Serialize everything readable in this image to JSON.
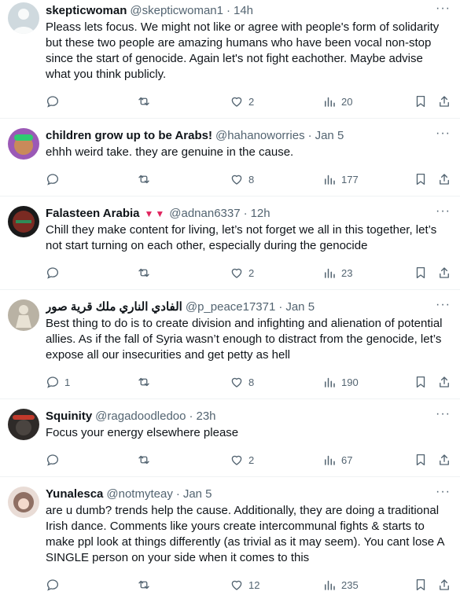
{
  "tweets": [
    {
      "name": "skepticwoman",
      "name_extra": "",
      "handle": "@skepticwoman1",
      "time": "14h",
      "text": "Pleass lets focus. We might not like or agree with people's form of solidarity but these two people are amazing humans who have been vocal non-stop since the start of genocide. Again let's not fight eachother. Maybe advise what you think publicly.",
      "replies": "",
      "retweets": "",
      "likes": "2",
      "views": "20",
      "avatar_color": "#cfd9de"
    },
    {
      "name": "children grow up to be Arabs!",
      "name_extra": "",
      "handle": "@hahanoworries",
      "time": "Jan 5",
      "text": "ehhh weird take. they are genuine in the cause.",
      "replies": "",
      "retweets": "",
      "likes": "8",
      "views": "177",
      "avatar_color": "#c98a5a"
    },
    {
      "name": "Falasteen Arabia",
      "name_extra": "▼▼",
      "handle": "@adnan6337",
      "time": "12h",
      "text": "Chill they make content for living, let’s not forget we all in this together, let’s not start turning on each other, especially during the genocide",
      "replies": "",
      "retweets": "",
      "likes": "2",
      "views": "23",
      "avatar_color": "#7a2a22"
    },
    {
      "name": "الفادي الناري ملك قرية صور",
      "name_extra": "",
      "handle": "@p_peace17371",
      "time": "Jan 5",
      "text": "Best thing to do is to create division and infighting and alienation of potential allies. As if the fall of Syria wasn’t enough to distract from the genocide, let’s expose all our insecurities and get petty as hell",
      "replies": "1",
      "retweets": "",
      "likes": "8",
      "views": "190",
      "avatar_color": "#b9b2a4"
    },
    {
      "name": "Squinity",
      "name_extra": "",
      "handle": "@ragadoodledoo",
      "time": "23h",
      "text": "Focus your energy elsewhere please",
      "replies": "",
      "retweets": "",
      "likes": "2",
      "views": "67",
      "avatar_color": "#2e2a28"
    },
    {
      "name": "Yunalesca",
      "name_extra": "",
      "handle": "@notmyteay",
      "time": "Jan 5",
      "text": "are u dumb? trends help the cause. Additionally, they are doing a traditional Irish dance. Comments like yours create intercommunal fights & starts to make ppl look at things differently (as trivial as it may seem). You cant lose A SINGLE person on your side when it comes to this",
      "replies": "",
      "retweets": "",
      "likes": "12",
      "views": "235",
      "avatar_color": "#8f6f63"
    }
  ],
  "sep": "·",
  "more": "···"
}
